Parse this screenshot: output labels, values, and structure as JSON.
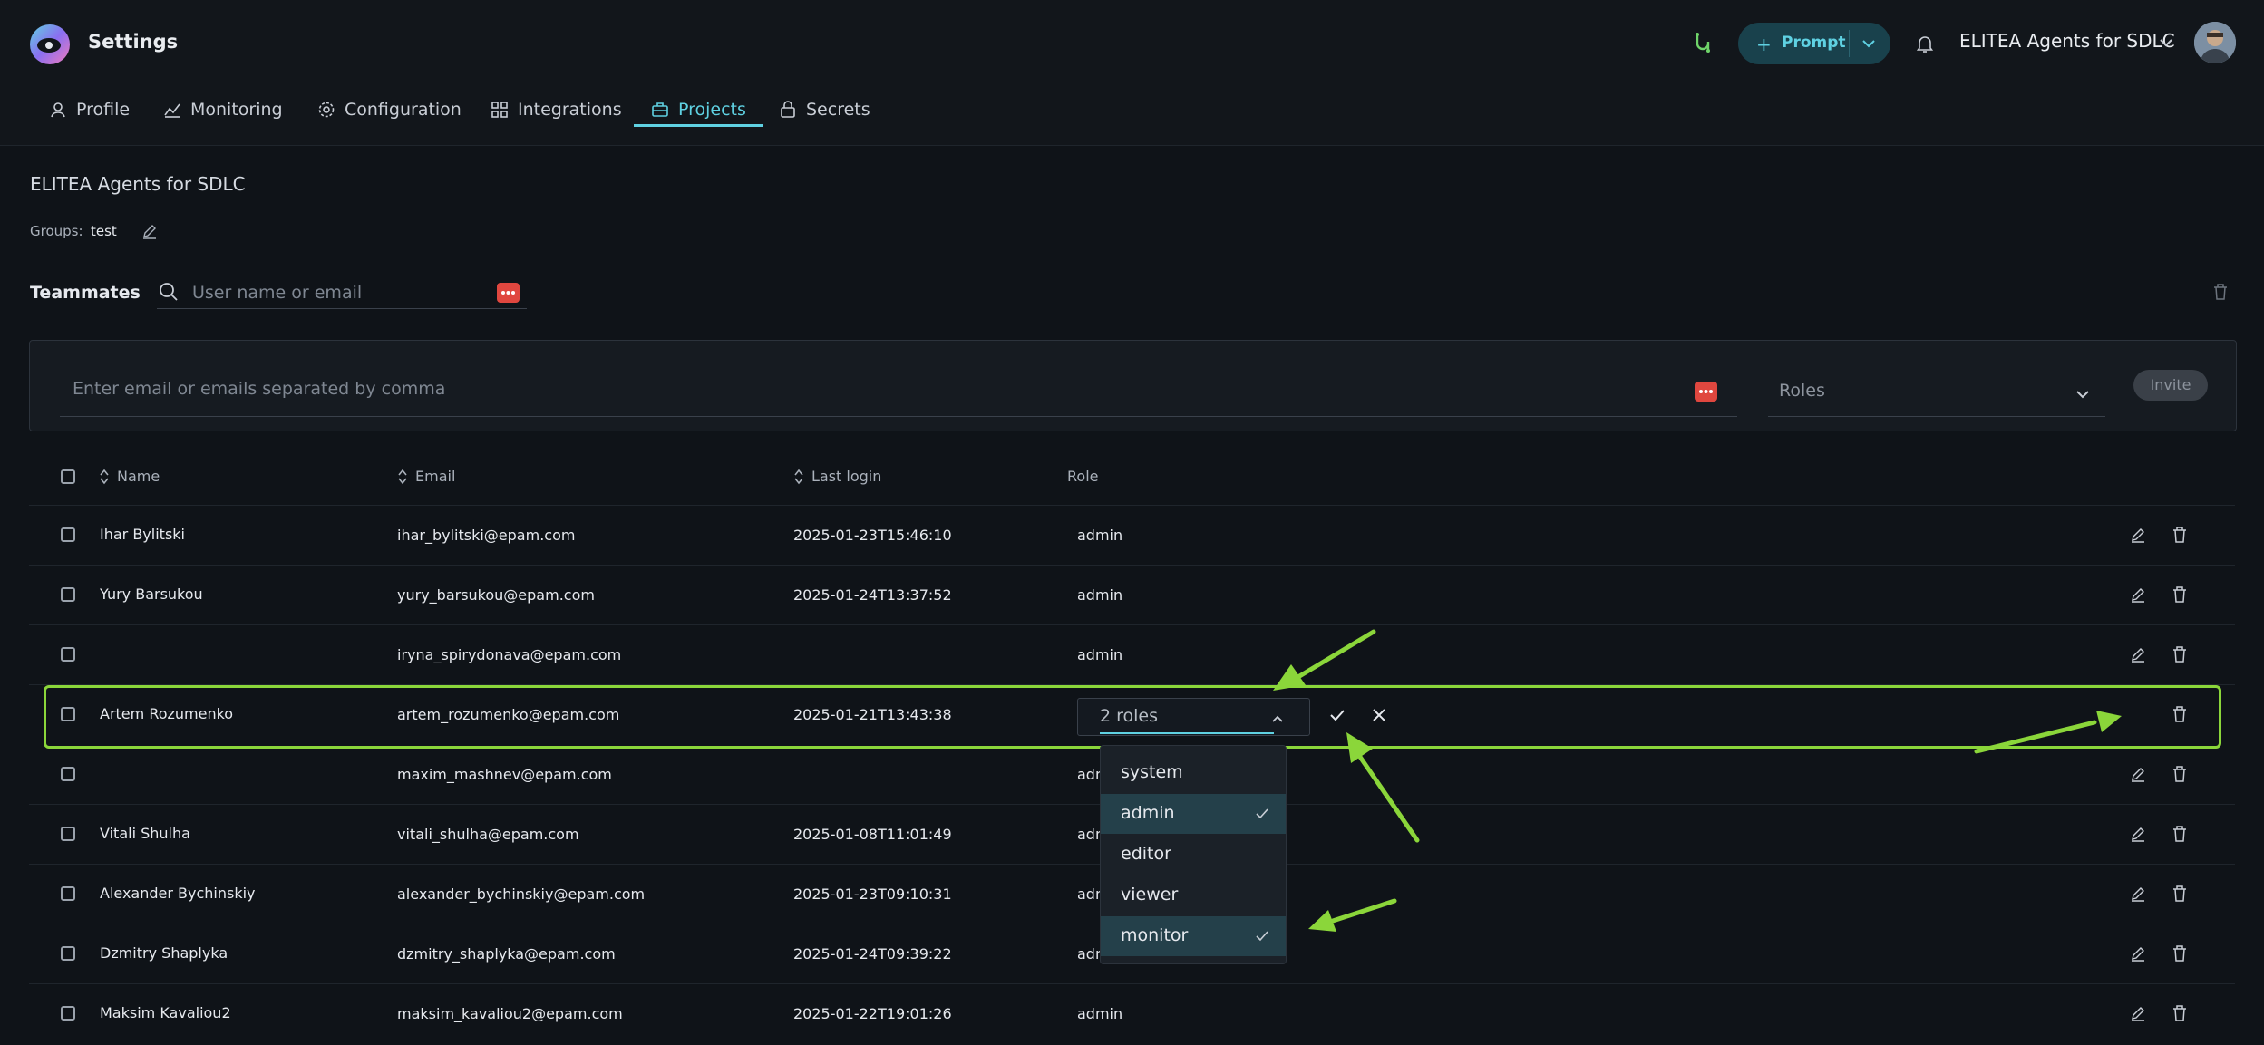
{
  "header": {
    "title": "Settings",
    "tabs": [
      {
        "label": "Profile",
        "icon": "user-icon"
      },
      {
        "label": "Monitoring",
        "icon": "monitoring-icon"
      },
      {
        "label": "Configuration",
        "icon": "gear-icon"
      },
      {
        "label": "Integrations",
        "icon": "grid-icon"
      },
      {
        "label": "Projects",
        "icon": "briefcase-icon",
        "active": true
      },
      {
        "label": "Secrets",
        "icon": "lock-icon"
      }
    ],
    "prompt_button": "Prompt",
    "project_name": "ELITEA Agents for SDLC"
  },
  "project": {
    "title": "ELITEA Agents for SDLC",
    "groups_label": "Groups:",
    "groups_value": "test"
  },
  "teammates": {
    "label": "Teammates",
    "search_placeholder": "User name or email"
  },
  "invite": {
    "placeholder": "Enter email or emails separated by comma",
    "roles_placeholder": "Roles",
    "button": "Invite"
  },
  "table": {
    "headers": {
      "name": "Name",
      "email": "Email",
      "last_login": "Last login",
      "role": "Role"
    },
    "rows": [
      {
        "name": "Ihar Bylitski",
        "email": "ihar_bylitski@epam.com",
        "last_login": "2025-01-23T15:46:10",
        "role": "admin"
      },
      {
        "name": "Yury Barsukou",
        "email": "yury_barsukou@epam.com",
        "last_login": "2025-01-24T13:37:52",
        "role": "admin"
      },
      {
        "name": "",
        "email": "iryna_spirydonava@epam.com",
        "last_login": "",
        "role": "admin"
      },
      {
        "name": "Artem Rozumenko",
        "email": "artem_rozumenko@epam.com",
        "last_login": "2025-01-21T13:43:38",
        "role": "2 roles",
        "editing": true
      },
      {
        "name": "",
        "email": "maxim_mashnev@epam.com",
        "last_login": "",
        "role": "adm"
      },
      {
        "name": "Vitali Shulha",
        "email": "vitali_shulha@epam.com",
        "last_login": "2025-01-08T11:01:49",
        "role": "adm"
      },
      {
        "name": "Alexander Bychinskiy",
        "email": "alexander_bychinskiy@epam.com",
        "last_login": "2025-01-23T09:10:31",
        "role": "adm"
      },
      {
        "name": "Dzmitry Shaplyka",
        "email": "dzmitry_shaplyka@epam.com",
        "last_login": "2025-01-24T09:39:22",
        "role": "adm"
      },
      {
        "name": "Maksim Kavaliou2",
        "email": "maksim_kavaliou2@epam.com",
        "last_login": "2025-01-22T19:01:26",
        "role": "admin"
      }
    ]
  },
  "role_dropdown": {
    "options": [
      {
        "label": "system",
        "selected": false
      },
      {
        "label": "admin",
        "selected": true
      },
      {
        "label": "editor",
        "selected": false
      },
      {
        "label": "viewer",
        "selected": false
      },
      {
        "label": "monitor",
        "selected": true
      }
    ]
  },
  "colors": {
    "accent": "#5fd1e2",
    "highlight": "#8bd63a",
    "background": "#0f1318",
    "danger": "#e0473f"
  }
}
